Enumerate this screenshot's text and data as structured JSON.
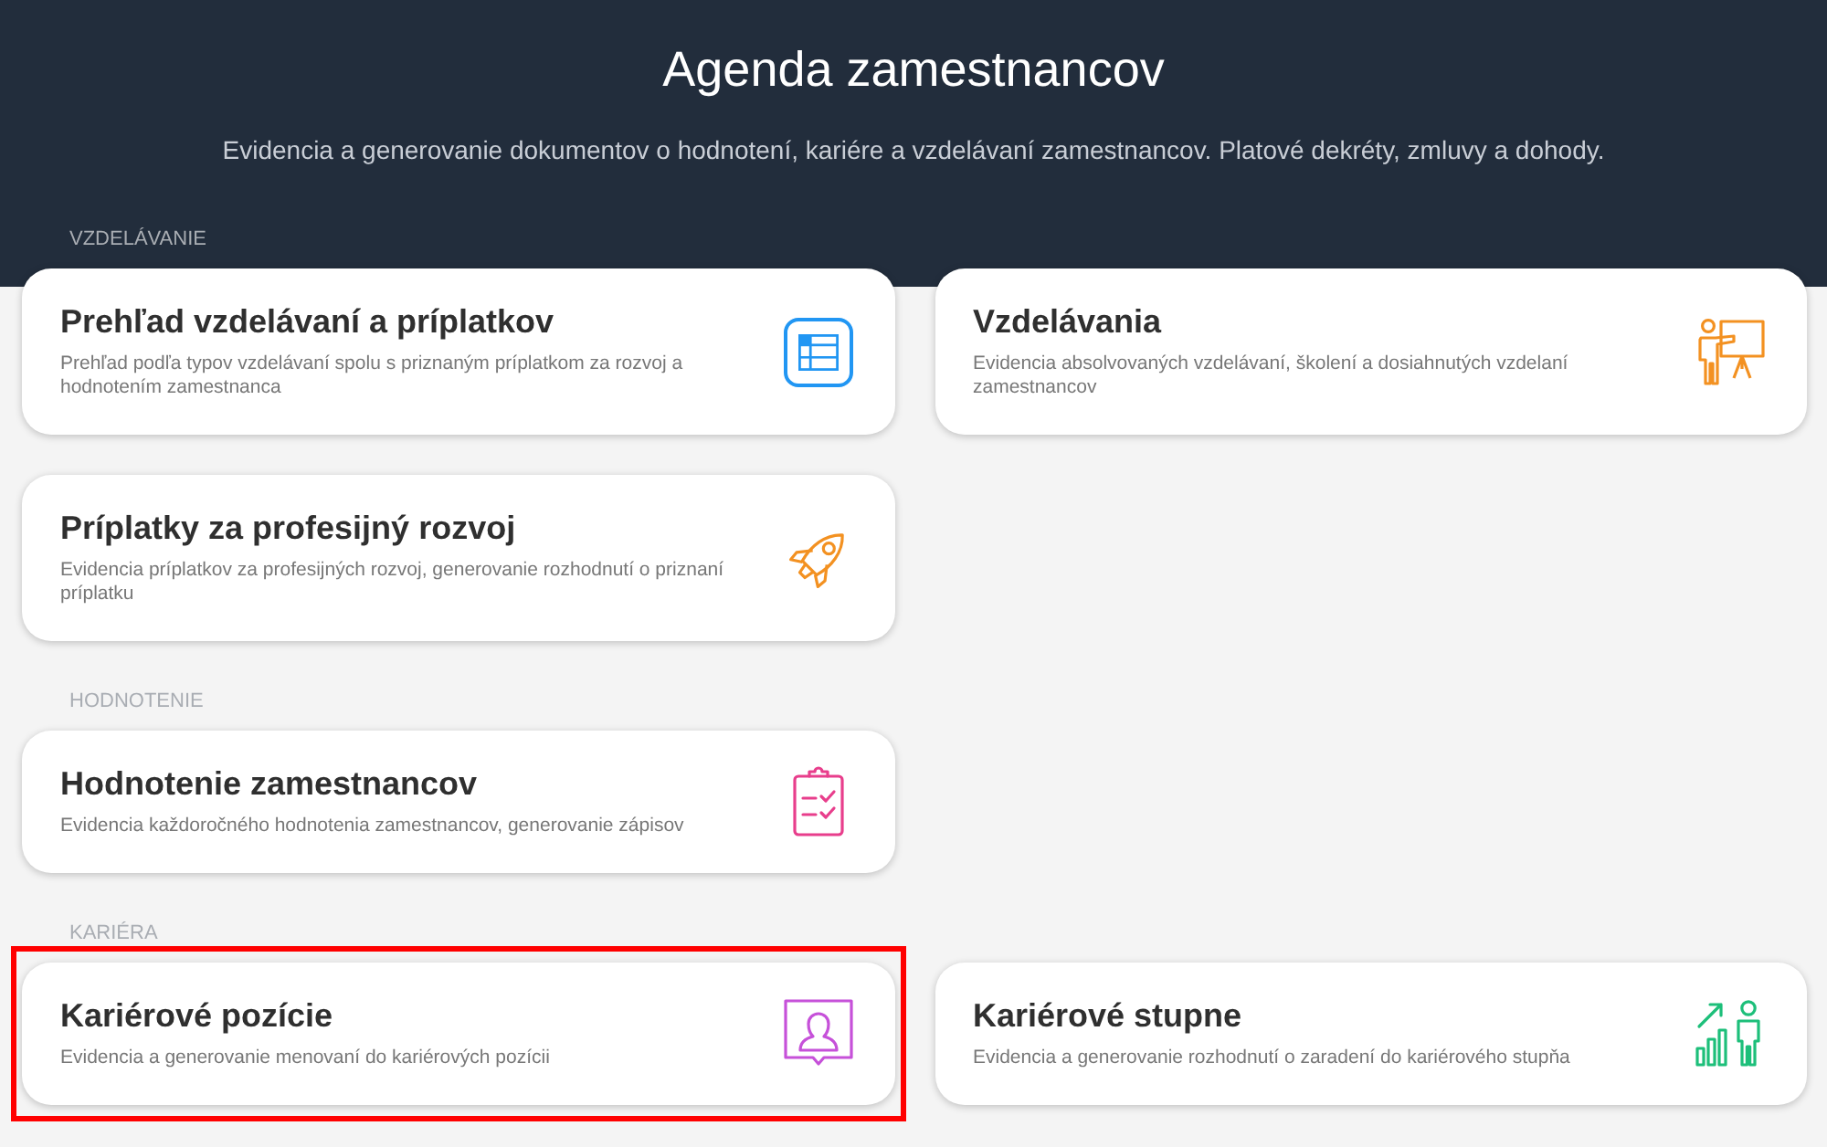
{
  "header": {
    "title": "Agenda zamestnancov",
    "subtitle": "Evidencia a generovanie dokumentov o hodnotení, kariére a vzdelávaní zamestnancov. Platové dekréty, zmluvy a dohody."
  },
  "sections": [
    {
      "label": "VZDELÁVANIE",
      "cards": [
        {
          "title": "Prehľad vzdelávaní a príplatkov",
          "description": "Prehľad podľa typov vzdelávaní spolu s priznaným príplatkom za rozvoj a hodnotením zamestnanca",
          "highlighted": false
        },
        {
          "title": "Vzdelávania",
          "description": "Evidencia absolvovaných vzdelávaní, školení a dosiahnutých vzdelaní zamestnancov",
          "highlighted": false
        },
        {
          "title": "Príplatky za profesijný rozvoj",
          "description": "Evidencia príplatkov za profesijných rozvoj, generovanie rozhodnutí o priznaní príplatku",
          "highlighted": false
        }
      ]
    },
    {
      "label": "HODNOTENIE",
      "cards": [
        {
          "title": "Hodnotenie zamestnancov",
          "description": "Evidencia každoročného hodnotenia zamestnancov, generovanie zápisov",
          "highlighted": false
        }
      ]
    },
    {
      "label": "KARIÉRA",
      "cards": [
        {
          "title": "Kariérové pozície",
          "description": "Evidencia a generovanie menovaní do kariérových pozícii",
          "highlighted": true
        },
        {
          "title": "Kariérové stupne",
          "description": "Evidencia a generovanie rozhodnutí o zaradení do kariérového stupňa",
          "highlighted": false
        }
      ]
    }
  ]
}
